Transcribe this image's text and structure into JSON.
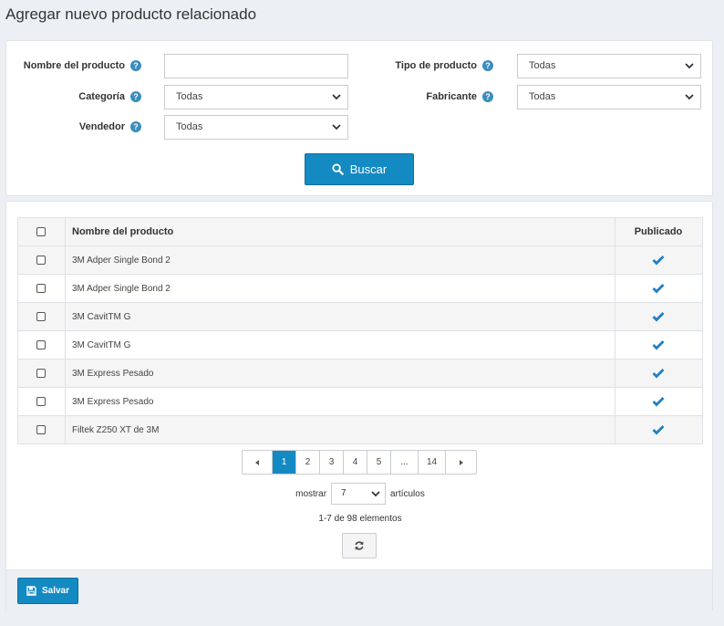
{
  "page": {
    "title": "Agregar nuevo producto relacionado"
  },
  "search": {
    "product_name_label": "Nombre del producto",
    "product_name_value": "",
    "product_type_label": "Tipo de producto",
    "product_type_value": "Todas",
    "category_label": "Categoría",
    "category_value": "Todas",
    "manufacturer_label": "Fabricante",
    "manufacturer_value": "Todas",
    "vendor_label": "Vendedor",
    "vendor_value": "Todas",
    "help_glyph": "?",
    "search_button": "Buscar"
  },
  "grid": {
    "columns": {
      "name": "Nombre del producto",
      "published": "Publicado"
    },
    "rows": [
      {
        "name": "3M Adper Single Bond 2",
        "published": true
      },
      {
        "name": "3M Adper Single Bond 2",
        "published": true
      },
      {
        "name": "3M CavitTM G",
        "published": true
      },
      {
        "name": "3M CavitTM G",
        "published": true
      },
      {
        "name": "3M Express Pesado",
        "published": true
      },
      {
        "name": "3M Express Pesado",
        "published": true
      },
      {
        "name": "Filtek Z250 XT de 3M",
        "published": true
      }
    ]
  },
  "pagination": {
    "prev": "◄",
    "pages": [
      "1",
      "2",
      "3",
      "4",
      "5",
      "...",
      "14"
    ],
    "current": "1",
    "next": "►",
    "show_label": "mostrar",
    "page_size": "7",
    "items_label": "artículos",
    "summary": "1-7 de 98 elementos"
  },
  "footer": {
    "save_button": "Salvar"
  },
  "colors": {
    "accent": "#148ac2",
    "help": "#3c8dbc",
    "check": "#1f7fc2"
  },
  "icons": {
    "search": "search-icon",
    "help": "help-icon",
    "check": "check-icon",
    "refresh": "refresh-icon",
    "save": "floppy-disk-icon",
    "chevron": "chevron-down-icon"
  }
}
